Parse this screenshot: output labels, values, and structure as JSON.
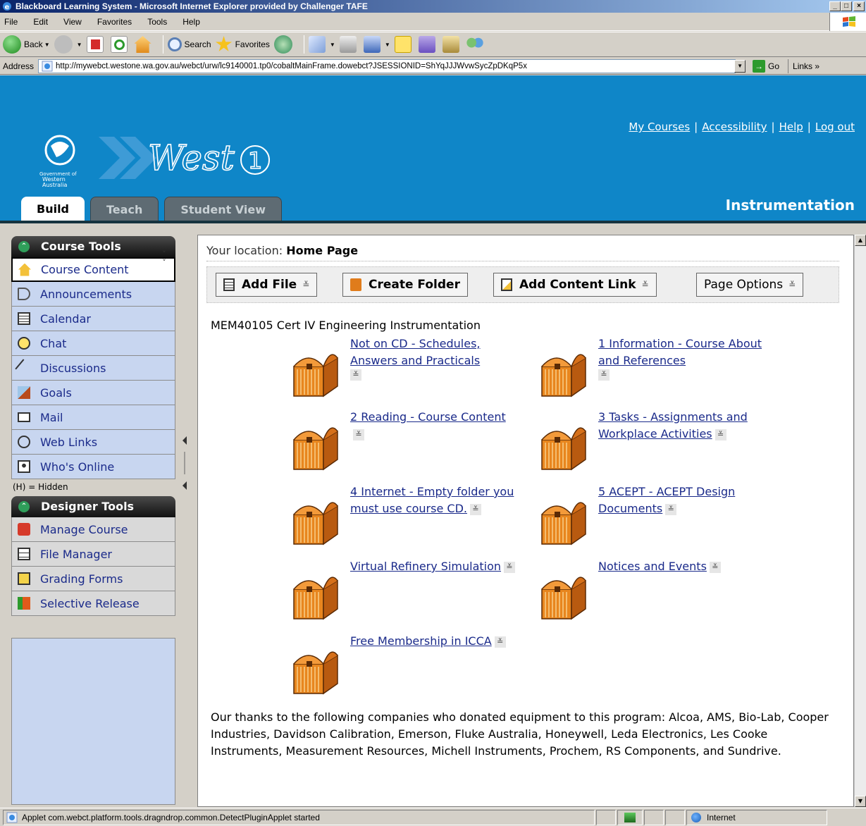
{
  "window": {
    "title": "Blackboard Learning System - Microsoft Internet Explorer provided by Challenger TAFE",
    "buttons": [
      "_",
      "□",
      "×"
    ]
  },
  "menu": [
    "File",
    "Edit",
    "View",
    "Favorites",
    "Tools",
    "Help"
  ],
  "toolbar": {
    "back": "Back",
    "search": "Search",
    "favorites": "Favorites"
  },
  "address": {
    "label": "Address",
    "url": "http://mywebct.westone.wa.gov.au/webct/urw/lc9140001.tp0/cobaltMainFrame.dowebct?JSESSIONID=ShYqJJJWvwSycZpDKqP5x",
    "go": "Go",
    "links": "Links"
  },
  "header": {
    "links": [
      "My Courses",
      "Accessibility",
      "Help",
      "Log out"
    ],
    "tabs": [
      "Build",
      "Teach",
      "Student View"
    ],
    "course_title": "Instrumentation",
    "gov_text": "Government of Western Australia"
  },
  "sidebar": {
    "course_tools_title": "Course Tools",
    "course_tools": [
      "Course Content",
      "Announcements",
      "Calendar",
      "Chat",
      "Discussions",
      "Goals",
      "Mail",
      "Web Links",
      "Who's Online"
    ],
    "hidden_note": "(H) = Hidden",
    "designer_tools_title": "Designer Tools",
    "designer_tools": [
      "Manage Course",
      "File Manager",
      "Grading Forms",
      "Selective Release"
    ]
  },
  "content": {
    "location_label": "Your location:",
    "location_value": "Home Page",
    "actions": {
      "add_file": "Add File",
      "create_folder": "Create Folder",
      "add_content_link": "Add Content Link",
      "page_options": "Page Options"
    },
    "course_name": "MEM40105 Cert IV Engineering Instrumentation",
    "folders": [
      "Not on CD - Schedules, Answers and Practicals",
      "1 Information - Course About and References",
      "2 Reading - Course Content",
      "3 Tasks - Assignments and Workplace Activities",
      "4 Internet - Empty folder you must use course CD.",
      "5 ACEPT - ACEPT Design Documents",
      "Virtual Refinery Simulation",
      "Notices and Events",
      "Free Membership in ICCA"
    ],
    "thanks": "Our thanks to the following companies who donated equipment to this program: Alcoa, AMS, Bio-Lab, Cooper Industries, Davidson Calibration, Emerson, Fluke Australia, Honeywell, Leda Electronics, Les Cooke Instruments, Measurement Resources, Michell Instruments, Prochem, RS Components, and Sundrive."
  },
  "status": {
    "text": "Applet com.webct.platform.tools.dragndrop.common.DetectPluginApplet started",
    "zone": "Internet"
  }
}
